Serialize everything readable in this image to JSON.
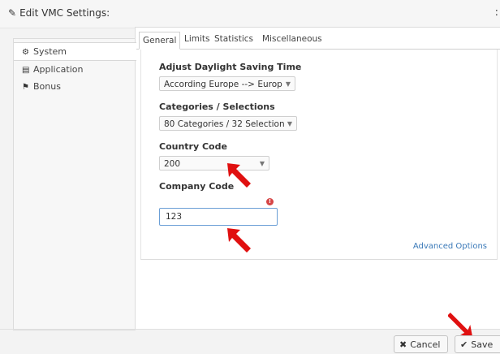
{
  "window": {
    "title": "Edit VMC Settings:",
    "close_glyph": ":"
  },
  "sidebar": {
    "items": [
      {
        "icon": "gear-icon",
        "glyph": "⚙",
        "label": "System"
      },
      {
        "icon": "document-icon",
        "glyph": "▤",
        "label": "Application"
      },
      {
        "icon": "gift-icon",
        "glyph": "⚑",
        "label": "Bonus"
      }
    ]
  },
  "tabs": [
    "General",
    "Limits",
    "Statistics",
    "Miscellaneous"
  ],
  "form": {
    "dst_label": "Adjust Daylight Saving Time",
    "dst_value": "According Europe --> Europ",
    "categories_label": "Categories / Selections",
    "categories_value": "80 Categories / 32 Selection",
    "country_label": "Country Code",
    "country_value": "200",
    "company_label": "Company Code",
    "company_value": "123",
    "advanced_link": "Advanced Options"
  },
  "buttons": {
    "cancel": "Cancel",
    "save": "Save"
  },
  "colors": {
    "accent_link": "#3a79b8",
    "annotation_arrow": "#e01010",
    "input_focus": "#6b9fd6"
  }
}
